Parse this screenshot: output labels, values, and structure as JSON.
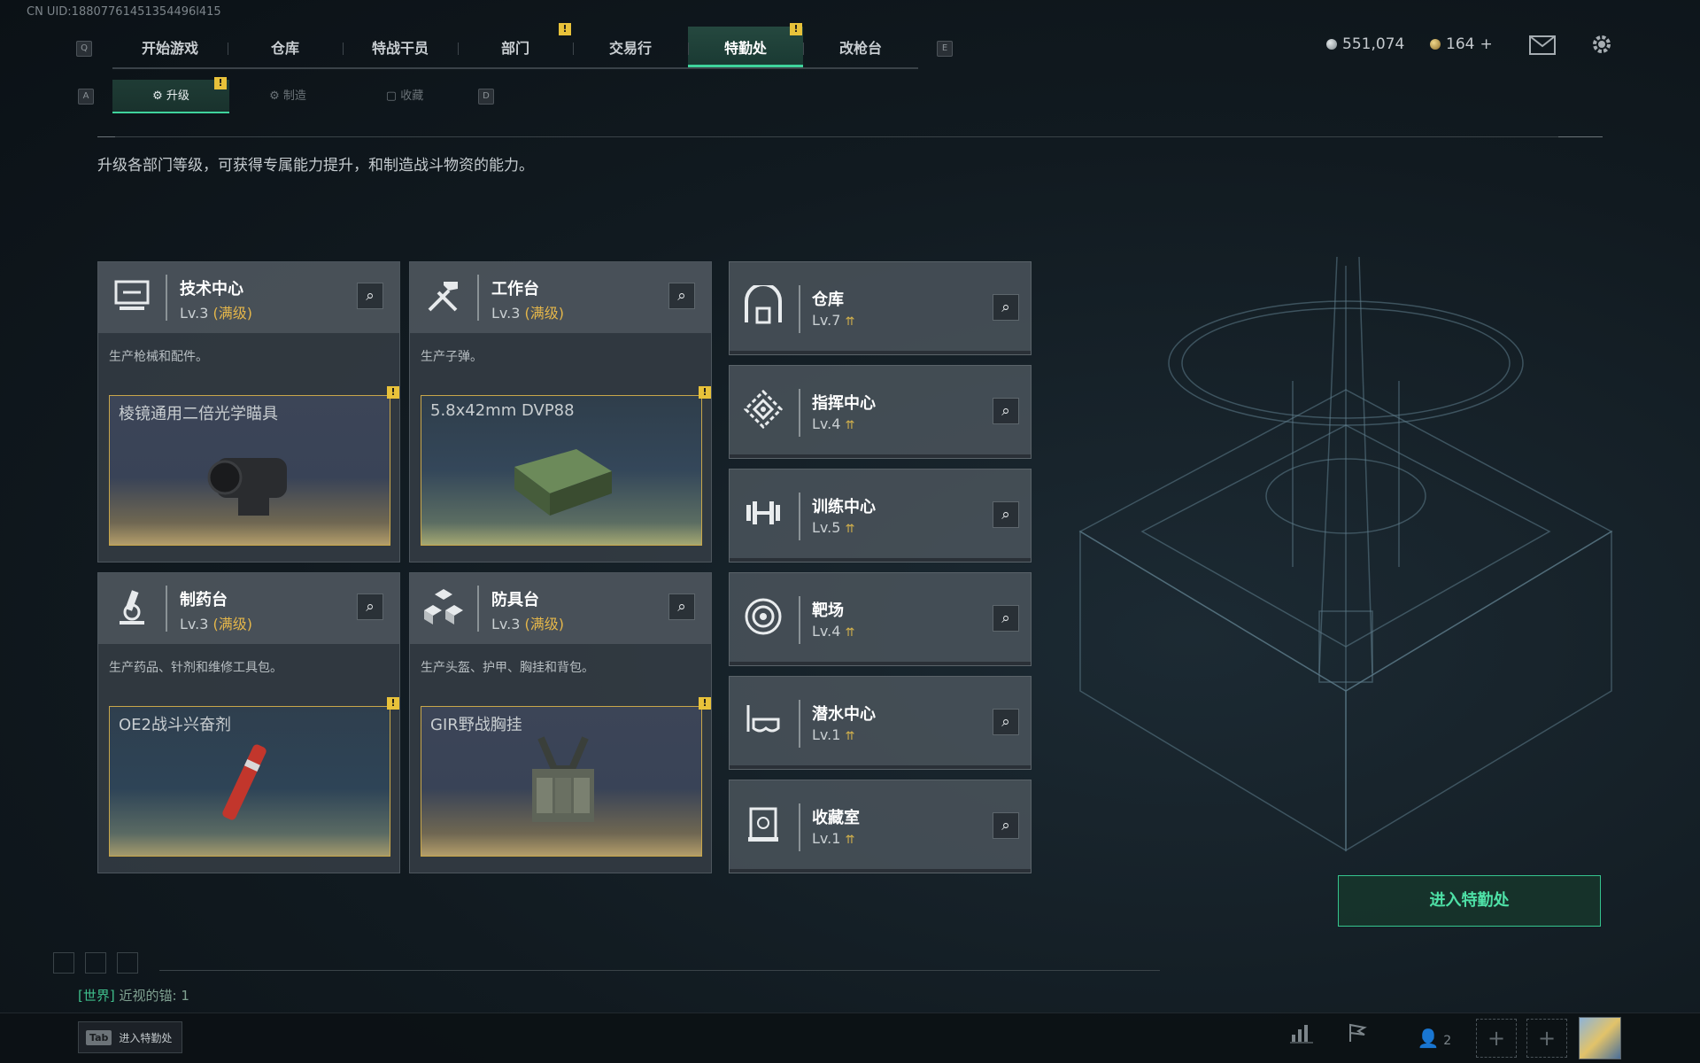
{
  "uid": "CN UID:18807761451354496l415",
  "nav": {
    "key_left": "Q",
    "key_right": "E",
    "tabs": [
      {
        "label": "开始游戏"
      },
      {
        "label": "仓库"
      },
      {
        "label": "特战干员"
      },
      {
        "label": "部门"
      },
      {
        "label": "交易行"
      },
      {
        "label": "特勤处"
      },
      {
        "label": "改枪台"
      }
    ],
    "active_tab": "特勤处",
    "warn_mark": "!"
  },
  "currency": {
    "coins": "551,074",
    "tickets": "164",
    "tickets_add": "+"
  },
  "subnav": {
    "key_left": "A",
    "key_right": "D",
    "tabs": [
      {
        "label": "升级"
      },
      {
        "label": "制造"
      },
      {
        "label": "收藏"
      }
    ]
  },
  "description": "升级各部门等级，可获得专属能力提升，和制造战斗物资的能力。",
  "departments_main": [
    {
      "name": "技术中心",
      "level": "Lv.3",
      "max": "(满级)",
      "desc": "生产枪械和配件。",
      "product": "棱镜通用二倍光学瞄具",
      "icon": "workstation-icon"
    },
    {
      "name": "工作台",
      "level": "Lv.3",
      "max": "(满级)",
      "desc": "生产子弹。",
      "product": "5.8x42mm DVP88",
      "icon": "tools-icon"
    },
    {
      "name": "制药台",
      "level": "Lv.3",
      "max": "(满级)",
      "desc": "生产药品、针剂和维修工具包。",
      "product": "OE2战斗兴奋剂",
      "icon": "microscope-icon"
    },
    {
      "name": "防具台",
      "level": "Lv.3",
      "max": "(满级)",
      "desc": "生产头盔、护甲、胸挂和背包。",
      "product": "GIR野战胸挂",
      "icon": "cubes-icon"
    }
  ],
  "departments_side": [
    {
      "name": "仓库",
      "level": "Lv.7",
      "icon": "warehouse-icon"
    },
    {
      "name": "指挥中心",
      "level": "Lv.4",
      "icon": "command-icon"
    },
    {
      "name": "训练中心",
      "level": "Lv.5",
      "icon": "dumbbell-icon"
    },
    {
      "name": "靶场",
      "level": "Lv.4",
      "icon": "target-icon"
    },
    {
      "name": "潜水中心",
      "level": "Lv.1",
      "icon": "diving-mask-icon"
    },
    {
      "name": "收藏室",
      "level": "Lv.1",
      "icon": "collection-icon"
    }
  ],
  "enter_button": "进入特勤处",
  "chat": {
    "channel": "[世界]",
    "text": "近视的锚: 1"
  },
  "bottom": {
    "tab_key": "Tab",
    "tab_hint": "进入特勤处",
    "friends_count": "2"
  },
  "colors": {
    "accent": "#3fd39c",
    "warning": "#e8c23a",
    "max_level": "#e4b64a"
  }
}
